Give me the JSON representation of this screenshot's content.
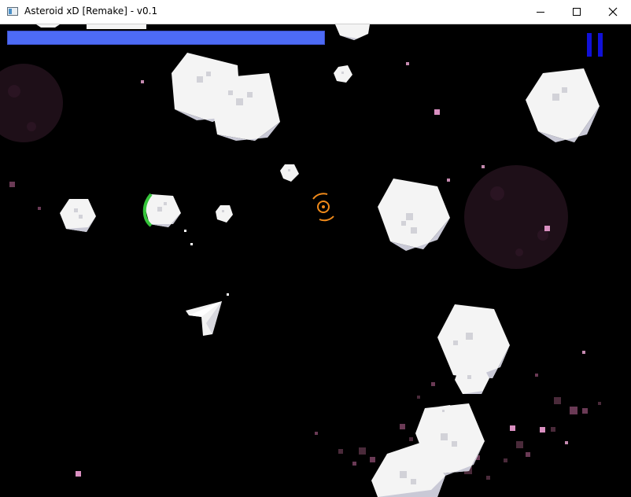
{
  "window": {
    "title": "Asteroid xD [Remake] - v0.1",
    "icon": "app-window-icon",
    "controls": [
      "minimize-icon",
      "maximize-icon",
      "close-icon"
    ]
  },
  "hud": {
    "health_fraction": 1.0,
    "health_color": "#4d6bf5",
    "pause_icon": "pause-icon",
    "pause_color": "#1010d8"
  },
  "colors": {
    "asteroid": "#f4f4f4",
    "asteroid_shade": "#c9c9d6",
    "asteroid_face": "#d2d2d8",
    "planet": "#1e0f18",
    "reticle": "#f08a1a",
    "debris": "#d98fc0",
    "player": "#f2f2f2"
  }
}
